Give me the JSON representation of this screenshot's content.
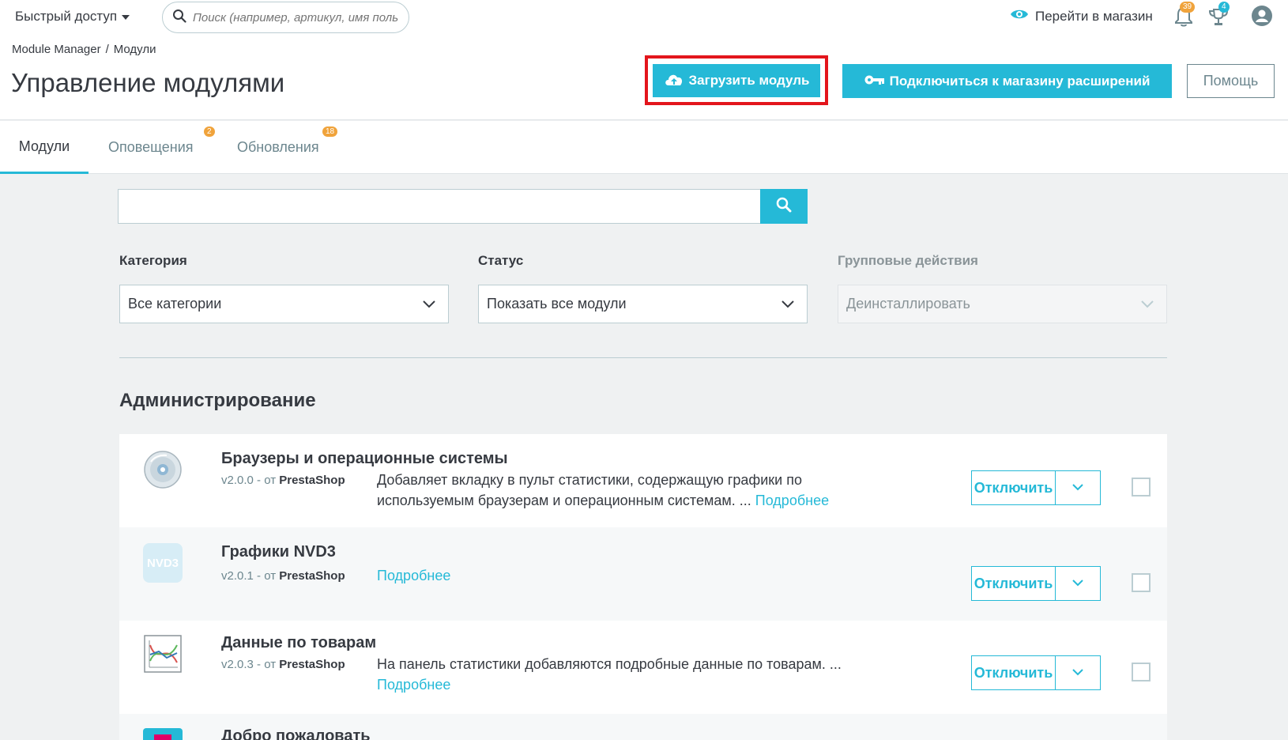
{
  "header": {
    "quick_access": "Быстрый доступ",
    "search_placeholder": "Поиск (например, артикул, имя пользователя...)",
    "view_store": "Перейти в магазин",
    "notifications_count": "39",
    "trophies_count": "4"
  },
  "breadcrumb": {
    "root": "Module Manager",
    "separator": "/",
    "current": "Модули"
  },
  "page": {
    "title": "Управление модулями"
  },
  "toolbar": {
    "upload_label": "Загрузить модуль",
    "connect_label": "Подключиться к магазину расширений",
    "help_label": "Помощь"
  },
  "tabs": [
    {
      "label": "Модули",
      "badge": ""
    },
    {
      "label": "Оповещения",
      "badge": "2"
    },
    {
      "label": "Обновления",
      "badge": "18"
    }
  ],
  "filters": {
    "category_label": "Категория",
    "category_value": "Все категории",
    "status_label": "Статус",
    "status_value": "Показать все модули",
    "bulk_label": "Групповые действия",
    "bulk_value": "Деинсталлировать"
  },
  "section": {
    "title": "Администрирование"
  },
  "modules": [
    {
      "name": "Браузеры и операционные системы",
      "version": "v2.0.0 - от",
      "author": "PrestaShop",
      "description": "Добавляет вкладку в пульт статистики, содержащую графики по используемым браузерам и операционным системам. ...",
      "more": "Подробнее",
      "action": "Отключить",
      "icon": "cd-icon"
    },
    {
      "name": "Графики NVD3",
      "version": "v2.0.1 - от",
      "author": "PrestaShop",
      "description": "",
      "more": "Подробнее",
      "action": "Отключить",
      "icon": "nvd3-icon",
      "icon_text": "NVD3"
    },
    {
      "name": "Данные по товарам",
      "version": "v2.0.3 - от",
      "author": "PrestaShop",
      "description": "На панель статистики добавляются подробные данные по товарам. ...",
      "more": "Подробнее",
      "action": "Отключить",
      "icon": "chart-icon"
    },
    {
      "name": "Добро пожаловать",
      "icon": "welcome-icon"
    }
  ],
  "colors": {
    "accent": "#25b9d7",
    "highlight_frame": "#e3151c",
    "badge": "#f0a33b"
  }
}
